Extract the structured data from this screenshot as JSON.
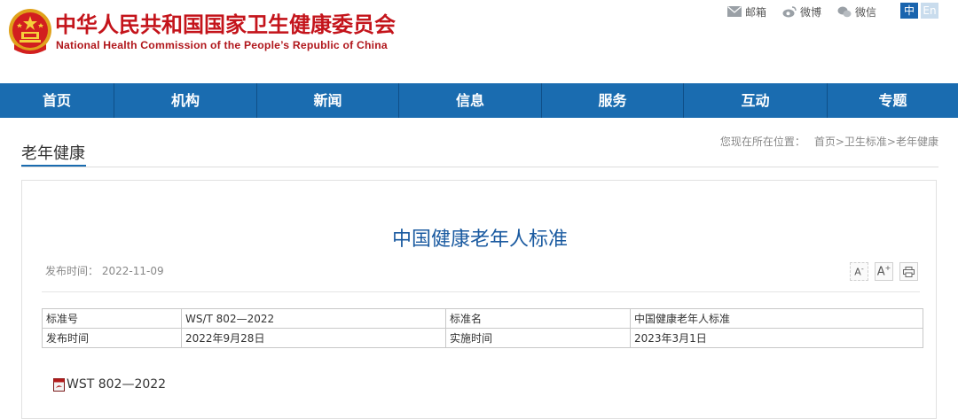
{
  "header": {
    "title_cn": "中华人民共和国国家卫生健康委员会",
    "title_en": "National Health Commission of the People’s Republic of China",
    "links": [
      {
        "label": "邮箱",
        "icon": "mail-icon"
      },
      {
        "label": "微博",
        "icon": "weibo-icon"
      },
      {
        "label": "微信",
        "icon": "wechat-icon"
      }
    ],
    "lang_zh": "中",
    "lang_en": "En"
  },
  "nav": {
    "items": [
      "首页",
      "机构",
      "新闻",
      "信息",
      "服务",
      "互动",
      "专题"
    ]
  },
  "section": {
    "title": "老年健康",
    "breadcrumb_label": "您现在所在位置：",
    "crumbs": [
      "首页",
      "卫生标准",
      "老年健康"
    ]
  },
  "article": {
    "title": "中国健康老年人标准",
    "publish_label": "发布时间：",
    "publish_date": "2022-11-09",
    "tools": {
      "font_smaller": "A",
      "font_larger": "A"
    },
    "table": [
      [
        "标准号",
        "WS/T 802—2022",
        "标准名",
        "中国健康老年人标准"
      ],
      [
        "发布时间",
        "2022年9月28日",
        "实施时间",
        "2023年3月1日"
      ]
    ],
    "attachment": "WST 802—2022"
  },
  "colors": {
    "brand_red": "#c4141b",
    "nav_blue": "#1a6cb0",
    "title_blue": "#1a5aa0"
  }
}
